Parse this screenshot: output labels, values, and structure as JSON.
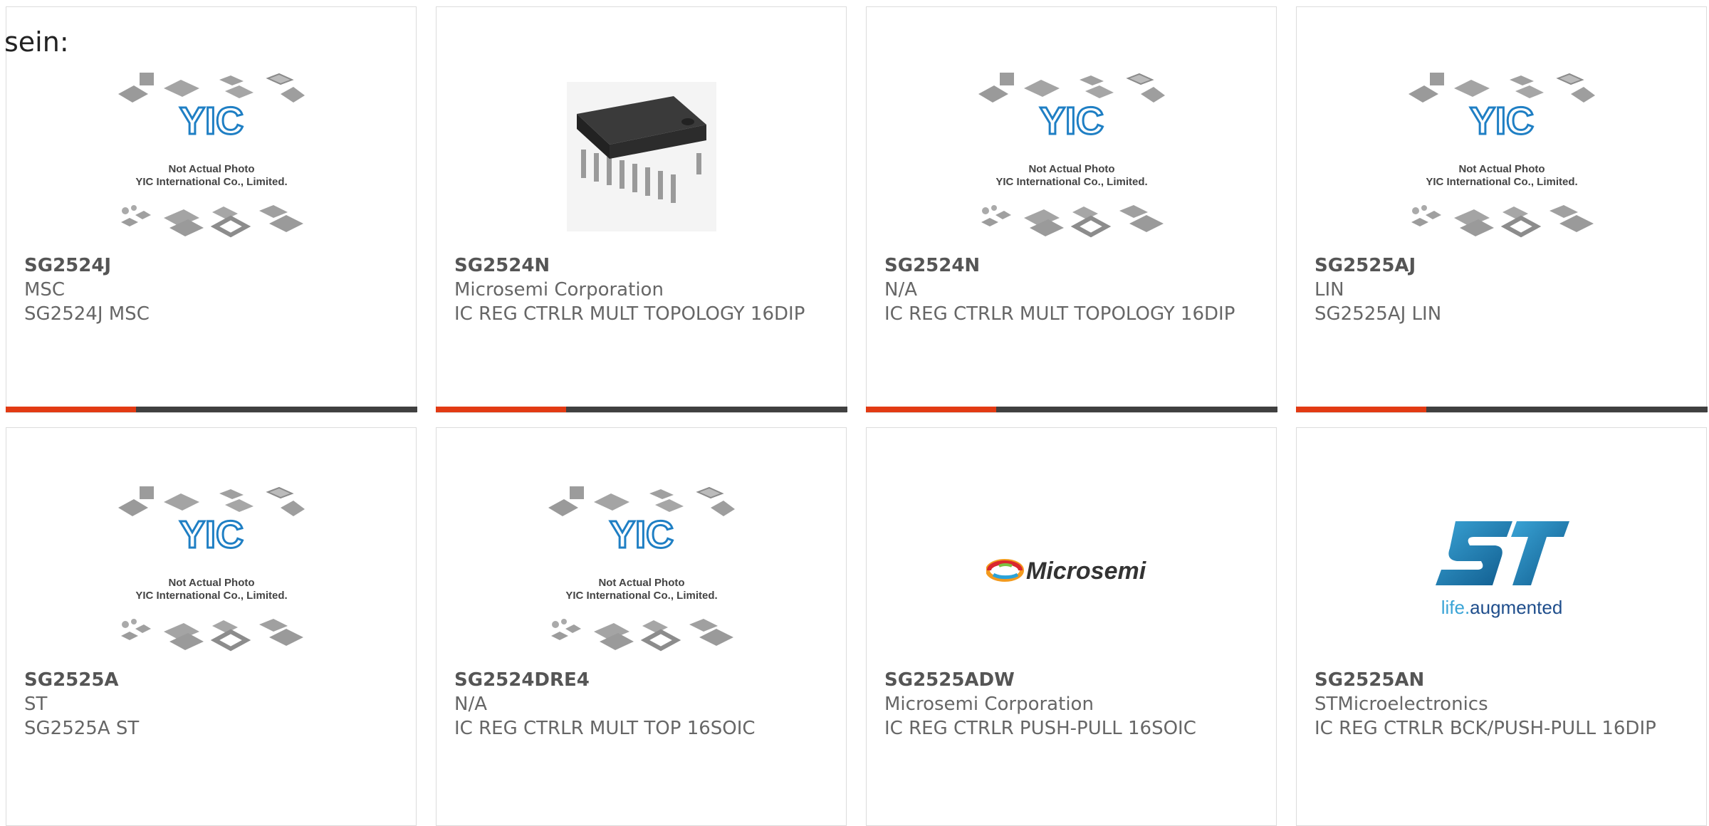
{
  "lead_text": "sein:",
  "placeholder_caption": {
    "line1": "Not Actual Photo",
    "line2": "YIC International Co., Limited.",
    "logo": "YIC"
  },
  "brand_logos": {
    "microsemi": "Microsemi",
    "st_tagline_a": "life.",
    "st_tagline_b": "augmented"
  },
  "products": [
    {
      "part": "SG2524J",
      "mfr": "MSC",
      "desc": "SG2524J MSC",
      "image": "placeholder"
    },
    {
      "part": "SG2524N",
      "mfr": "Microsemi Corporation",
      "desc": "IC REG CTRLR MULT TOPOLOGY 16DIP",
      "image": "dip-chip"
    },
    {
      "part": "SG2524N",
      "mfr": "N/A",
      "desc": "IC REG CTRLR MULT TOPOLOGY 16DIP",
      "image": "placeholder"
    },
    {
      "part": "SG2525AJ",
      "mfr": "LIN",
      "desc": "SG2525AJ LIN",
      "image": "placeholder"
    },
    {
      "part": "SG2525A",
      "mfr": "ST",
      "desc": "SG2525A ST",
      "image": "placeholder"
    },
    {
      "part": "SG2524DRE4",
      "mfr": "N/A",
      "desc": "IC REG CTRLR MULT TOP 16SOIC",
      "image": "placeholder"
    },
    {
      "part": "SG2525ADW",
      "mfr": "Microsemi Corporation",
      "desc": "IC REG CTRLR PUSH-PULL 16SOIC",
      "image": "microsemi-logo"
    },
    {
      "part": "SG2525AN",
      "mfr": "STMicroelectronics",
      "desc": "IC REG CTRLR BCK/PUSH-PULL 16DIP",
      "image": "st-logo"
    }
  ],
  "colors": {
    "accent": "#e23a13",
    "bar": "#404040",
    "yic_blue": "#1f7fc4"
  }
}
